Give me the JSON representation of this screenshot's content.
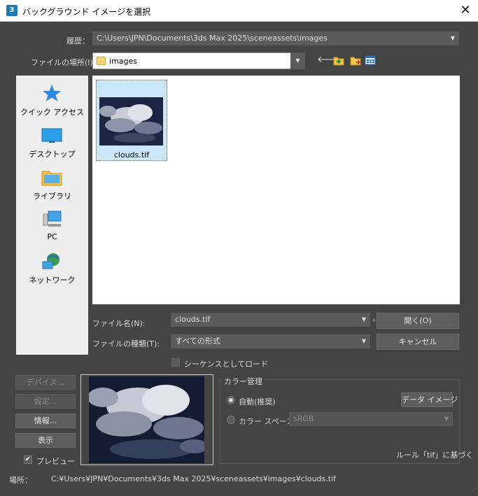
{
  "window": {
    "title": "バックグラウンド イメージを選択",
    "app_icon": "3ds-max-icon",
    "app_icon_text": "3",
    "close_label": "✕"
  },
  "history": {
    "label": "履歴：",
    "value": "C:\\Users\\JPN\\Documents\\3ds Max 2025\\sceneassets\\images"
  },
  "location": {
    "label": "ファイルの場所(I):",
    "value": "images",
    "toolbar": [
      "back-icon",
      "up-folder-icon",
      "new-folder-icon",
      "view-menu-icon"
    ]
  },
  "places": [
    {
      "label": "クイック アクセス",
      "icon": "star-icon"
    },
    {
      "label": "デスクトップ",
      "icon": "desktop-icon"
    },
    {
      "label": "ライブラリ",
      "icon": "library-icon"
    },
    {
      "label": "PC",
      "icon": "pc-icon"
    },
    {
      "label": "ネットワーク",
      "icon": "network-icon"
    }
  ],
  "files": [
    {
      "name": "clouds.tif",
      "selected": true
    }
  ],
  "filename": {
    "label": "ファイル名(N):",
    "value": "clouds.tif"
  },
  "filetype": {
    "label": "ファイルの種類(T):",
    "value": "すべての形式"
  },
  "buttons": {
    "open": "開く(O)",
    "cancel": "キャンセル",
    "devices": "デバイス...",
    "setup": "設定...",
    "info": "情報...",
    "view": "表示",
    "data_image": "データ イメージ"
  },
  "sequence": {
    "label": "シーケンスとしてロード",
    "checked": false
  },
  "preview": {
    "label": "プレビュー",
    "checked": true,
    "check_glyph": "✔"
  },
  "color_management": {
    "title": "カラー管理",
    "auto_label": "自動(推奨)",
    "auto_selected": true,
    "space_label": "カラー スペース:",
    "space_value": "sRGB",
    "rule": "ルール「tif」に基づく"
  },
  "status": {
    "label": "場所：",
    "path": "C:¥Users¥JPN¥Documents¥3ds Max 2025¥sceneassets¥images¥clouds.tif"
  },
  "colors": {
    "background": "#444444",
    "selection": "#cce8ff",
    "accent": "#1a7ab8"
  }
}
